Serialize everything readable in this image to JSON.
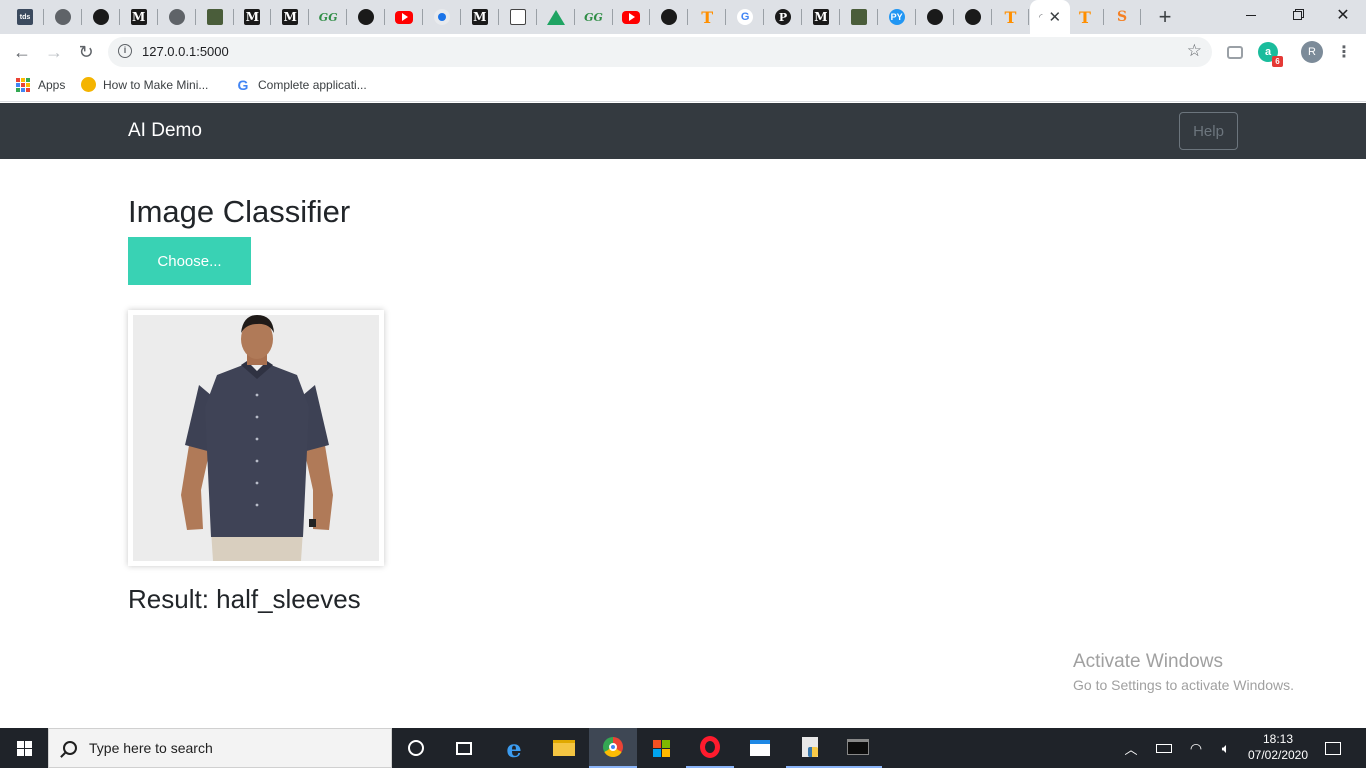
{
  "tabs": [
    {
      "icon": "tds-icon",
      "text": "tds"
    },
    {
      "icon": "globe-icon",
      "text": ""
    },
    {
      "icon": "github-icon",
      "text": ""
    },
    {
      "icon": "medium-icon",
      "text": "M"
    },
    {
      "icon": "globe-icon",
      "text": ""
    },
    {
      "icon": "image-icon",
      "text": ""
    },
    {
      "icon": "medium-icon",
      "text": "M"
    },
    {
      "icon": "medium-icon",
      "text": "M"
    },
    {
      "icon": "geeksforgeeks-icon",
      "text": "GG"
    },
    {
      "icon": "github-icon",
      "text": ""
    },
    {
      "icon": "youtube-icon",
      "text": ""
    },
    {
      "icon": "dot-icon",
      "text": ""
    },
    {
      "icon": "medium-icon",
      "text": "M"
    },
    {
      "icon": "document-icon",
      "text": ""
    },
    {
      "icon": "google-drive-icon",
      "text": ""
    },
    {
      "icon": "geeksforgeeks-icon",
      "text": "GG"
    },
    {
      "icon": "youtube-icon",
      "text": ""
    },
    {
      "icon": "github-icon",
      "text": ""
    },
    {
      "icon": "tensorflow-icon",
      "text": "T"
    },
    {
      "icon": "google-icon",
      "text": "G"
    },
    {
      "icon": "circle-p-icon",
      "text": "P"
    },
    {
      "icon": "medium-icon",
      "text": "M"
    },
    {
      "icon": "image-icon",
      "text": ""
    },
    {
      "icon": "pycharm-icon",
      "text": "PY"
    },
    {
      "icon": "github-icon",
      "text": ""
    },
    {
      "icon": "github-icon",
      "text": ""
    },
    {
      "icon": "tensorflow-icon",
      "text": "T"
    }
  ],
  "active_tab": {
    "close_glyph": "✕"
  },
  "tabs_after": [
    {
      "icon": "tensorflow-icon",
      "text": "T"
    },
    {
      "icon": "stackoverflow-icon",
      "text": "S"
    }
  ],
  "browser": {
    "url": "127.0.0.1:5000",
    "new_tab_glyph": "+",
    "profile_initial": "R",
    "extension_badge": "6"
  },
  "bookmarks": [
    {
      "label": "Apps",
      "icon": "apps-grid-icon"
    },
    {
      "label": "How to Make Mini...",
      "icon": "emoji-icon"
    },
    {
      "label": "Complete applicati...",
      "icon": "google-icon"
    }
  ],
  "page": {
    "brand": "AI Demo",
    "help_label": "Help",
    "title": "Image Classifier",
    "choose_label": "Choose...",
    "result_text": "Result: half_sleeves"
  },
  "watermark": {
    "line1": "Activate Windows",
    "line2": "Go to Settings to activate Windows."
  },
  "taskbar": {
    "search_placeholder": "Type here to search",
    "time": "18:13",
    "date": "07/02/2020"
  },
  "colors": {
    "navbar": "#343a40",
    "choose_button": "#39d2b4",
    "tabstrip": "#dee1e6",
    "taskbar": "#1f2329"
  }
}
